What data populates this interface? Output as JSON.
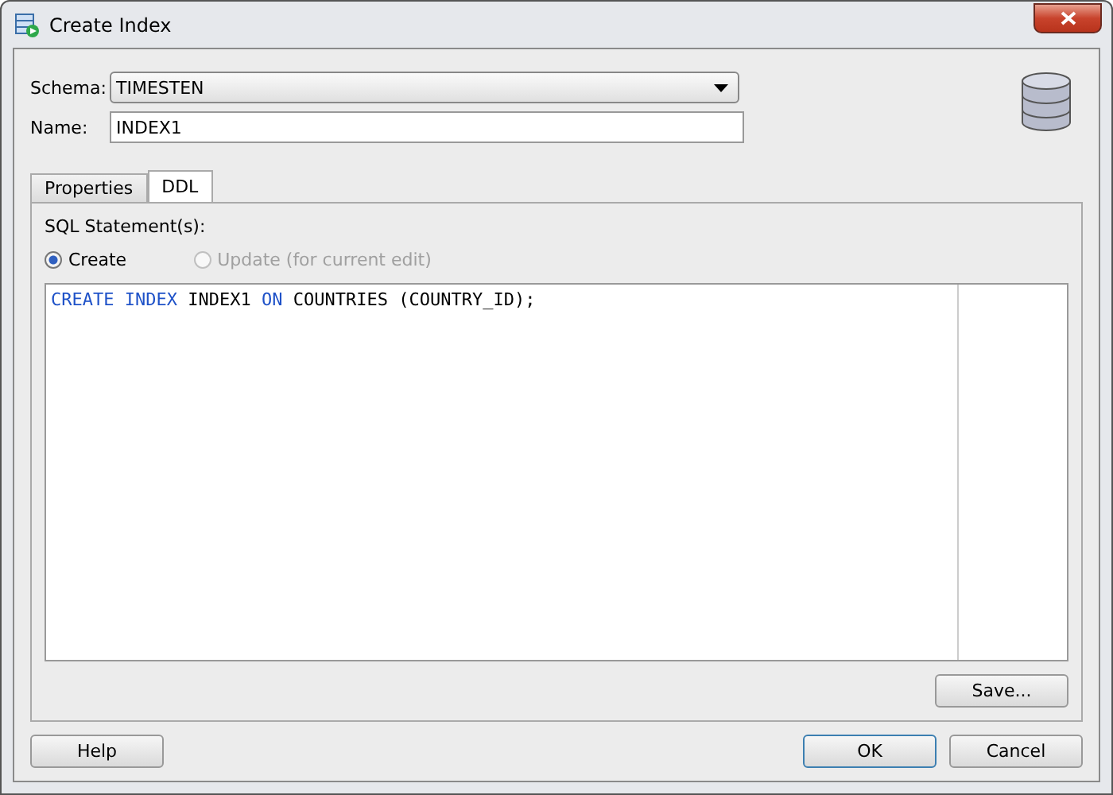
{
  "window": {
    "title": "Create Index"
  },
  "fields": [
    {
      "label": "Schema:",
      "value": "TIMESTEN",
      "kind": "dropdown"
    },
    {
      "label": "Name:",
      "value": "INDEX1",
      "kind": "text"
    }
  ],
  "tabs": [
    {
      "label": "Properties",
      "selected": false
    },
    {
      "label": "DDL",
      "selected": true
    }
  ],
  "ddl": {
    "heading": "SQL Statement(s):",
    "radios": [
      {
        "label": "Create",
        "selected": true,
        "disabled": false
      },
      {
        "label": "Update (for current edit)",
        "selected": false,
        "disabled": true
      }
    ],
    "code": [
      {
        "text": "CREATE",
        "kind": "keyword"
      },
      {
        "text": "INDEX",
        "kind": "keyword"
      },
      {
        "text": "INDEX1",
        "kind": "plain"
      },
      {
        "text": "ON",
        "kind": "keyword"
      },
      {
        "text": "COUNTRIES",
        "kind": "plain"
      },
      {
        "text": "(COUNTRY_ID);",
        "kind": "plain"
      }
    ],
    "save_button": "Save..."
  },
  "buttons": [
    {
      "label": "Help",
      "default": false
    },
    {
      "label": "OK",
      "default": true
    },
    {
      "label": "Cancel",
      "default": false
    }
  ]
}
